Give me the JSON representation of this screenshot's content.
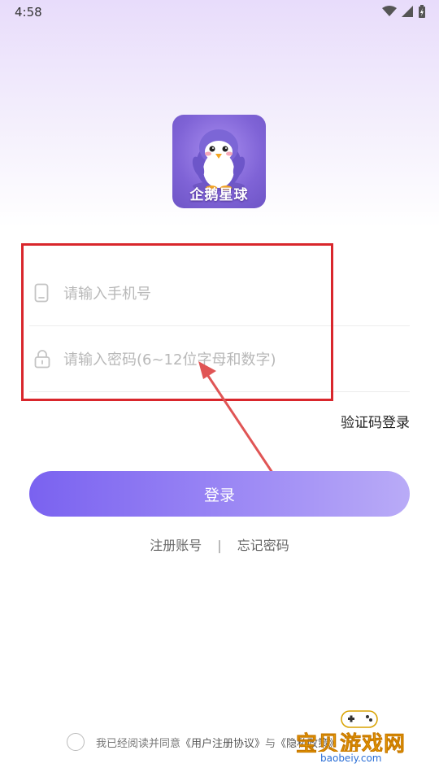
{
  "status_bar": {
    "time": "4:58"
  },
  "logo": {
    "text": "企鹅星球"
  },
  "form": {
    "phone_placeholder": "请输入手机号",
    "password_placeholder": "请输入密码(6~12位字母和数字)",
    "sms_login_label": "验证码登录",
    "login_button_label": "登录"
  },
  "links": {
    "register": "注册账号",
    "separator": "|",
    "forgot": "忘记密码"
  },
  "agreement": {
    "prefix": "我已经阅读并同意",
    "user_agreement": "《用户注册协议》",
    "and": "与",
    "privacy_policy": "《隐私政策》"
  },
  "watermark": {
    "title": "宝贝游戏网",
    "url": "baobeiy.com"
  },
  "colors": {
    "accent": "#7a62f0",
    "highlight_box": "#d9262c",
    "arrow": "#e05555"
  }
}
